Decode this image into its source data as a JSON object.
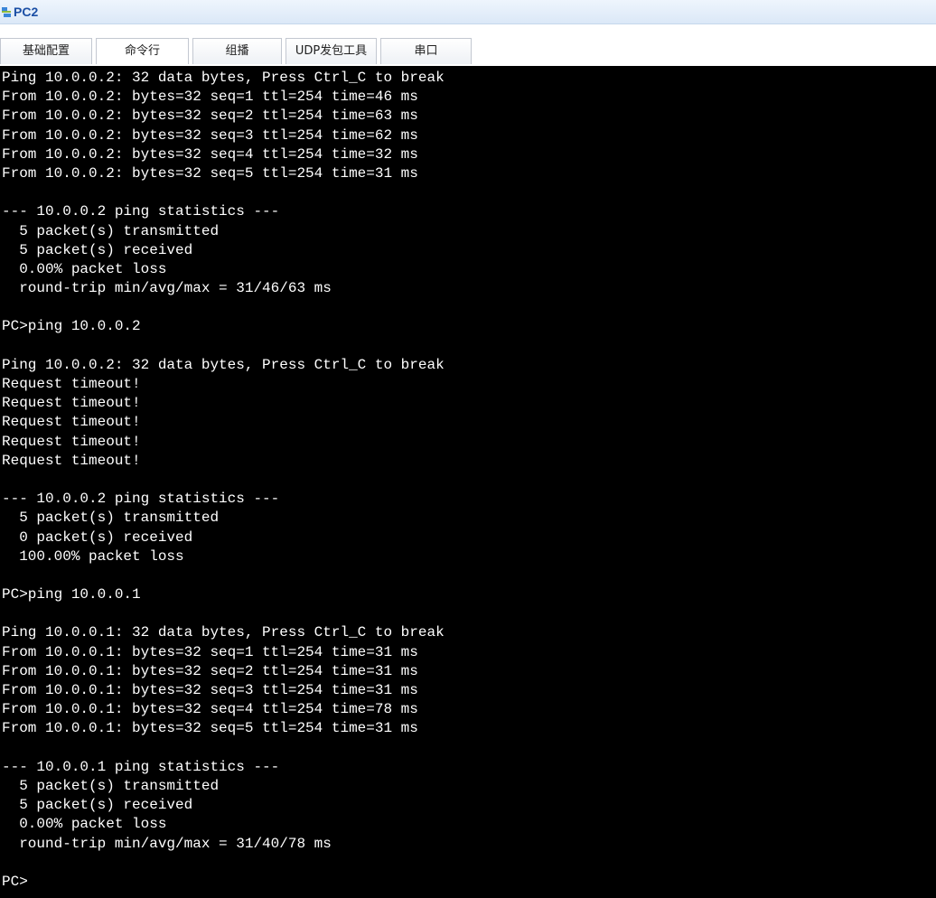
{
  "window": {
    "title": "PC2",
    "app_icon": "pc-network-icon"
  },
  "tabs": [
    {
      "label": "基础配置",
      "active": false
    },
    {
      "label": "命令行",
      "active": true
    },
    {
      "label": "组播",
      "active": false
    },
    {
      "label": "UDP发包工具",
      "active": false
    },
    {
      "label": "串口",
      "active": false
    }
  ],
  "terminal": {
    "background": "#000000",
    "foreground": "#ffffff",
    "lines": [
      "Ping 10.0.0.2: 32 data bytes, Press Ctrl_C to break",
      "From 10.0.0.2: bytes=32 seq=1 ttl=254 time=46 ms",
      "From 10.0.0.2: bytes=32 seq=2 ttl=254 time=63 ms",
      "From 10.0.0.2: bytes=32 seq=3 ttl=254 time=62 ms",
      "From 10.0.0.2: bytes=32 seq=4 ttl=254 time=32 ms",
      "From 10.0.0.2: bytes=32 seq=5 ttl=254 time=31 ms",
      "",
      "--- 10.0.0.2 ping statistics ---",
      "  5 packet(s) transmitted",
      "  5 packet(s) received",
      "  0.00% packet loss",
      "  round-trip min/avg/max = 31/46/63 ms",
      "",
      "PC>ping 10.0.0.2",
      "",
      "Ping 10.0.0.2: 32 data bytes, Press Ctrl_C to break",
      "Request timeout!",
      "Request timeout!",
      "Request timeout!",
      "Request timeout!",
      "Request timeout!",
      "",
      "--- 10.0.0.2 ping statistics ---",
      "  5 packet(s) transmitted",
      "  0 packet(s) received",
      "  100.00% packet loss",
      "",
      "PC>ping 10.0.0.1",
      "",
      "Ping 10.0.0.1: 32 data bytes, Press Ctrl_C to break",
      "From 10.0.0.1: bytes=32 seq=1 ttl=254 time=31 ms",
      "From 10.0.0.1: bytes=32 seq=2 ttl=254 time=31 ms",
      "From 10.0.0.1: bytes=32 seq=3 ttl=254 time=31 ms",
      "From 10.0.0.1: bytes=32 seq=4 ttl=254 time=78 ms",
      "From 10.0.0.1: bytes=32 seq=5 ttl=254 time=31 ms",
      "",
      "--- 10.0.0.1 ping statistics ---",
      "  5 packet(s) transmitted",
      "  5 packet(s) received",
      "  0.00% packet loss",
      "  round-trip min/avg/max = 31/40/78 ms",
      "",
      "PC>"
    ]
  }
}
